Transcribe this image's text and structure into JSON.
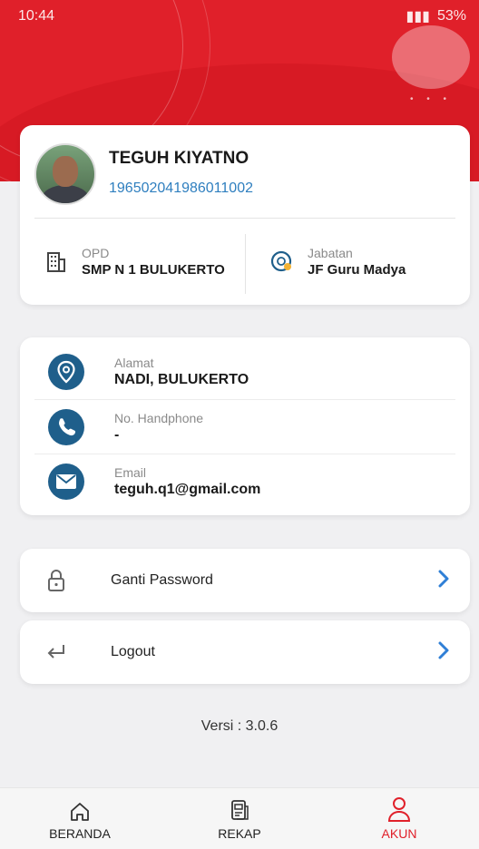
{
  "status_bar": {
    "time": "10:44",
    "battery": "53%"
  },
  "profile": {
    "name": "TEGUH KIYATNO",
    "nip": "196502041986011002",
    "opd_label": "OPD",
    "opd_value": "SMP N 1 BULUKERTO",
    "jabatan_label": "Jabatan",
    "jabatan_value": "JF Guru Madya"
  },
  "contact": {
    "address_label": "Alamat",
    "address_value": "NADI, BULUKERTO",
    "phone_label": "No. Handphone",
    "phone_value": "-",
    "email_label": "Email",
    "email_value": "teguh.q1@gmail.com"
  },
  "menu": {
    "change_password": "Ganti Password",
    "logout": "Logout"
  },
  "version": "Versi : 3.0.6",
  "nav": {
    "home": "BERANDA",
    "recap": "REKAP",
    "account": "AKUN"
  },
  "colors": {
    "brand_red": "#e0202a",
    "link_blue": "#2f7fbf",
    "icon_blue": "#1f5f8b"
  },
  "icons": [
    "building-icon",
    "jabatan-badge-icon",
    "location-pin-icon",
    "phone-icon",
    "email-icon",
    "lock-icon",
    "logout-arrow-icon",
    "chevron-right-icon",
    "home-icon",
    "recap-icon",
    "user-icon"
  ]
}
